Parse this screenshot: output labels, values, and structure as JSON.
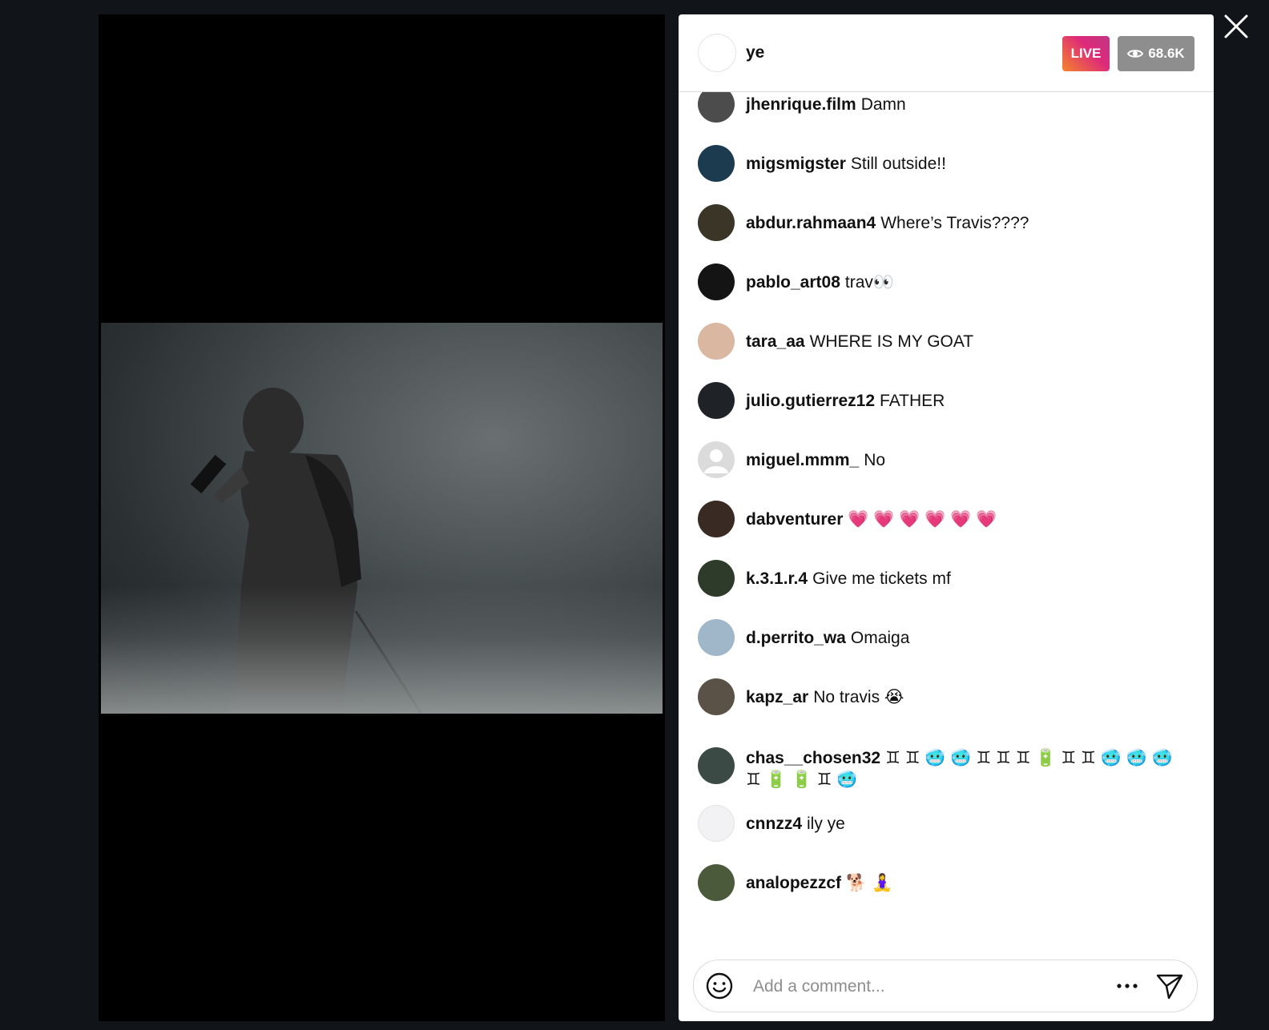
{
  "header": {
    "host_name": "ye",
    "live_label": "LIVE",
    "viewers": "68.6K"
  },
  "comments": [
    {
      "user": "jhenrique.film",
      "text": "Damn",
      "avatar": "#4c4c4c"
    },
    {
      "user": "migsmigster",
      "text": "Still outside!!",
      "avatar": "#1d3b4f"
    },
    {
      "user": "abdur.rahmaan4",
      "text": "Where’s Travis????",
      "avatar": "#3a3526"
    },
    {
      "user": "pablo_art08",
      "text": "trav👀",
      "avatar": "#141414"
    },
    {
      "user": "tara_aa",
      "text": "WHERE IS MY GOAT",
      "avatar": "#d9b7a0"
    },
    {
      "user": "julio.gutierrez12",
      "text": "FATHER",
      "avatar": "#1f2328"
    },
    {
      "user": "miguel.mmm_",
      "text": "No",
      "avatar": "#dbdbdb"
    },
    {
      "user": "dabventurer",
      "text": "💗 💗 💗 💗 💗 💗",
      "avatar": "#3a2a24"
    },
    {
      "user": "k.3.1.r.4",
      "text": "Give me tickets mf",
      "avatar": "#2e3b2a"
    },
    {
      "user": "d.perrito_wa",
      "text": "Omaiga",
      "avatar": "#9fb7c8"
    },
    {
      "user": "kapz_ar",
      "text": "No travis 😭",
      "avatar": "#5a5246"
    },
    {
      "user": "chas__chosen32",
      "text": "♊ ♊ 🥶 🥶 ♊ ♊ ♊ 🔋 ♊ ♊ 🥶 🥶 🥶 ♊ 🔋 🔋 ♊ 🥶",
      "avatar": "#3b4a44"
    },
    {
      "user": "cnnzz4",
      "text": "ily ye",
      "avatar": "#f2f2f4"
    },
    {
      "user": "analopezzcf",
      "text": "🐕 🧘‍♀️",
      "avatar": "#4c5a3c"
    }
  ],
  "composer": {
    "placeholder": "Add a comment..."
  },
  "icons": {
    "close": "close-icon",
    "eye": "eye-icon",
    "emoji": "emoji-icon",
    "more": "more-icon",
    "send": "send-icon"
  }
}
